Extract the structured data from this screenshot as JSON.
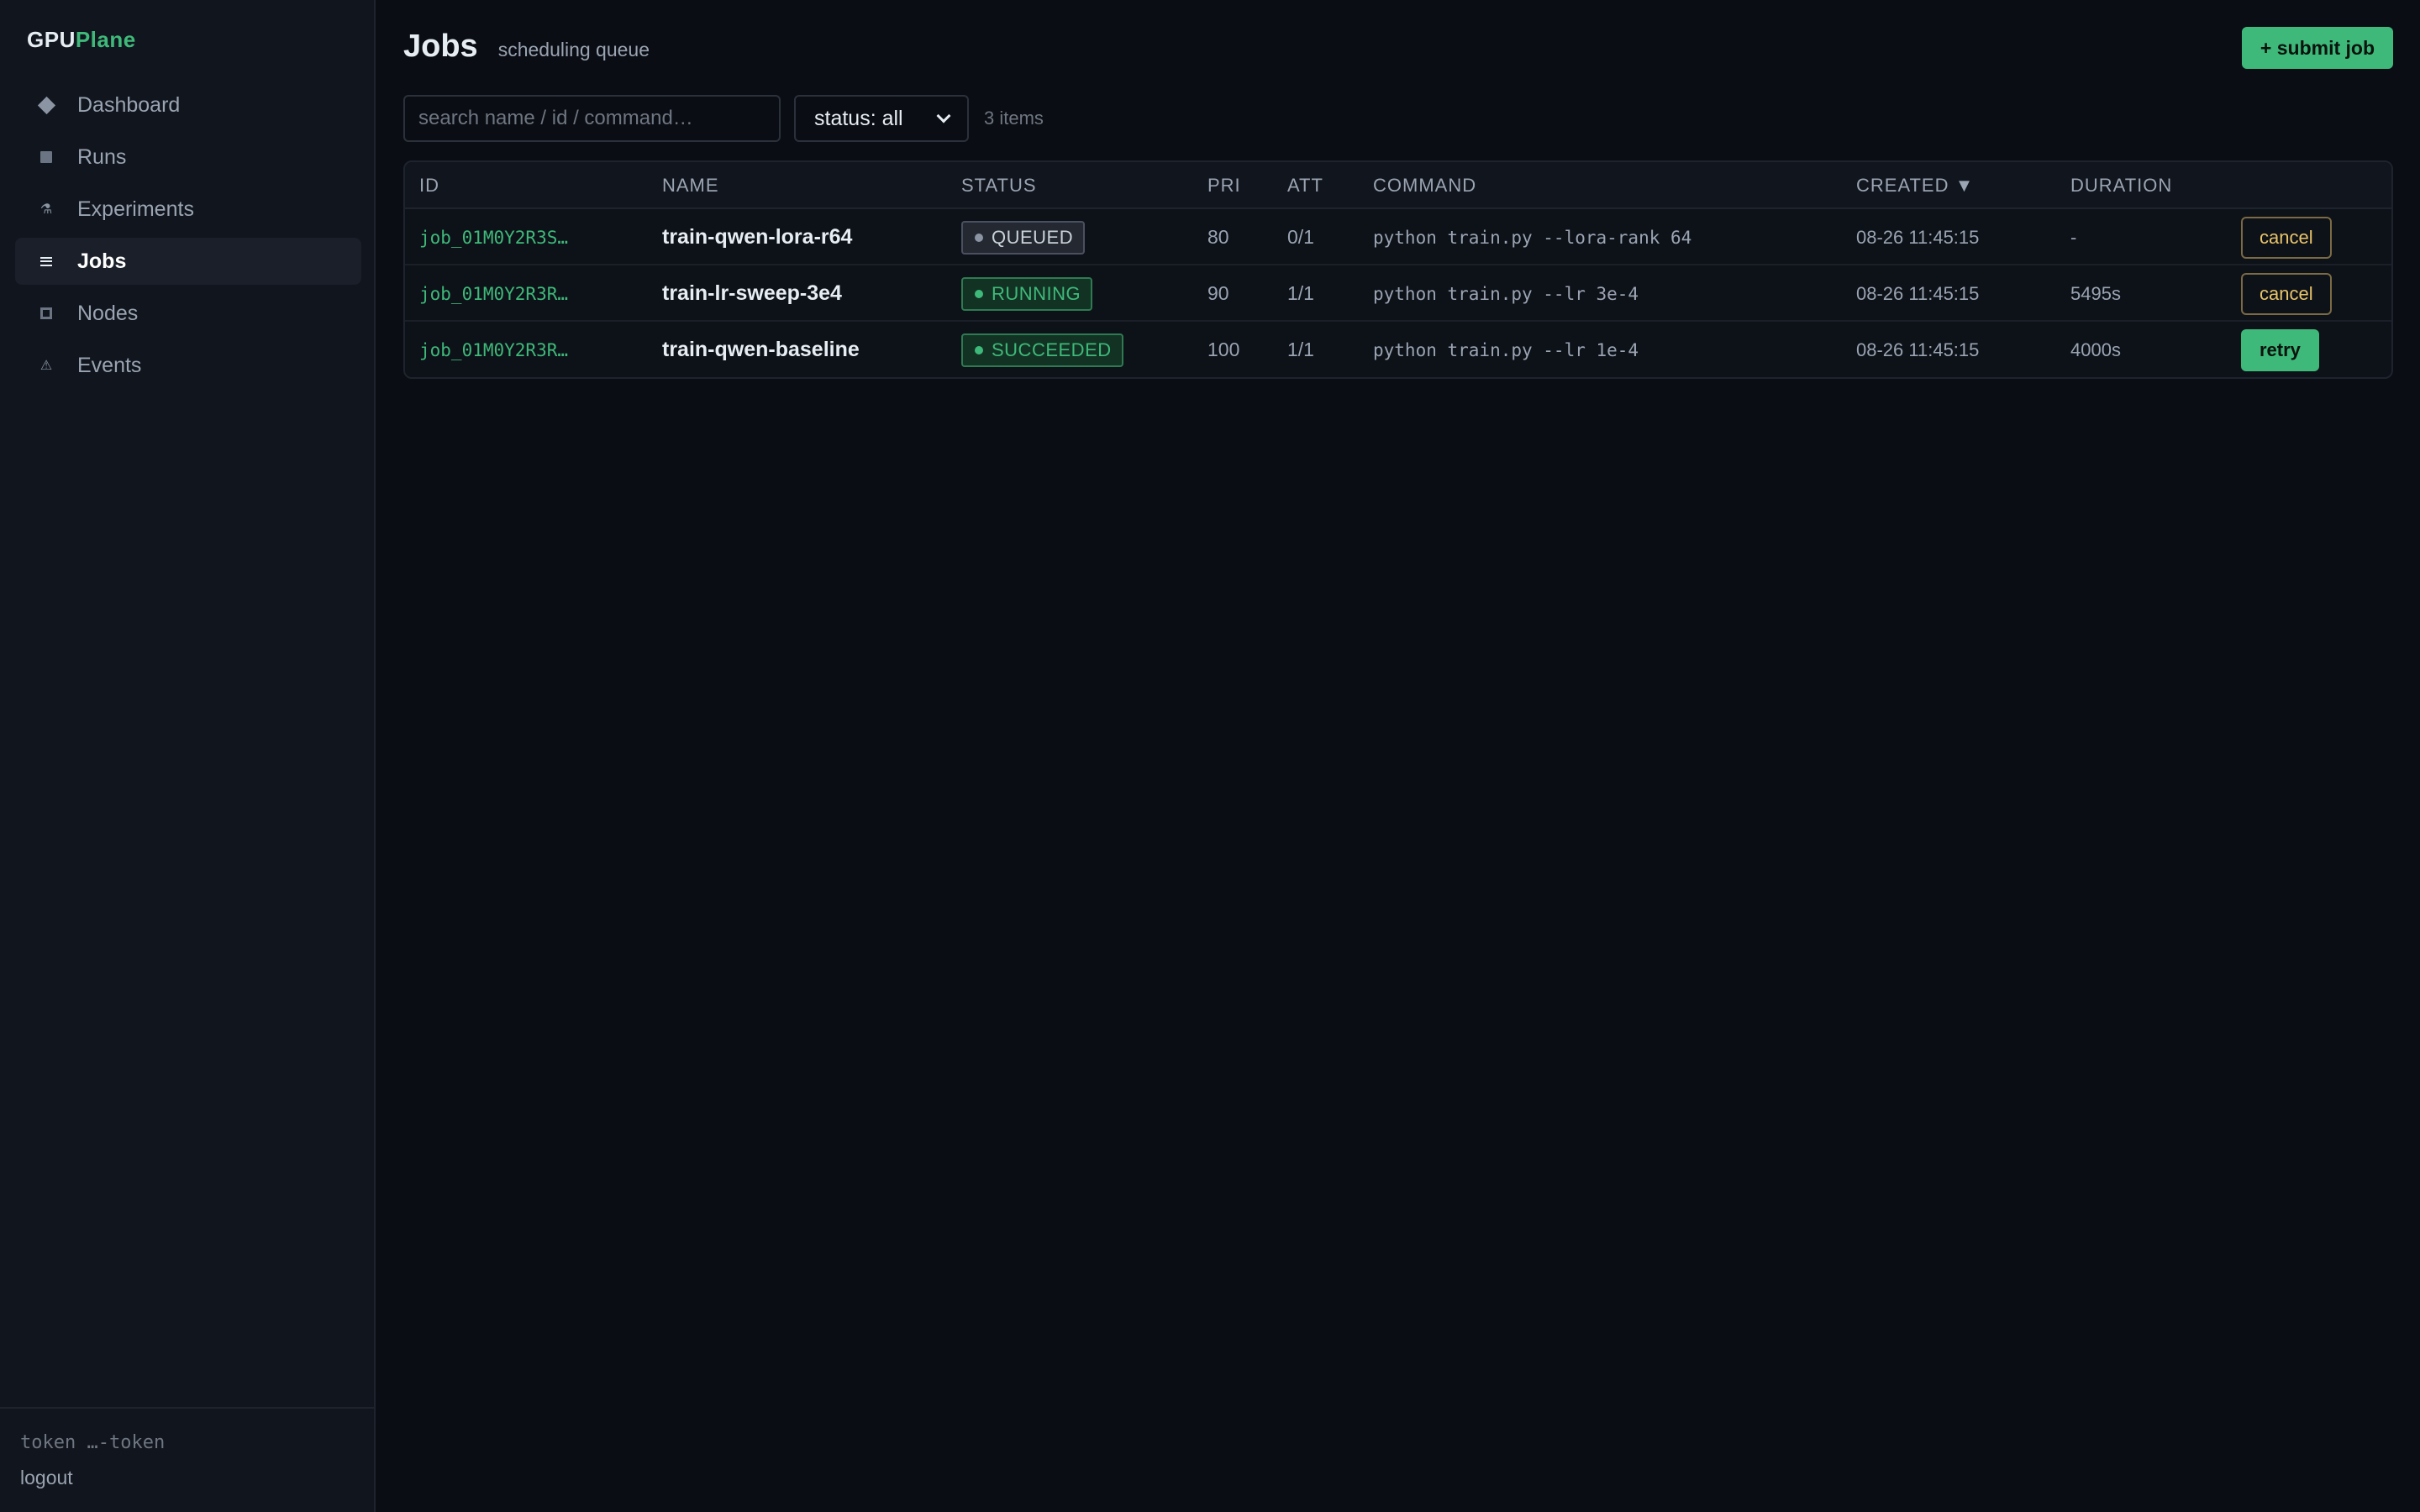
{
  "brand": {
    "part1": "GPU",
    "part2": "Plane"
  },
  "sidebar": {
    "items": [
      {
        "label": "Dashboard",
        "icon": "diamond-icon"
      },
      {
        "label": "Runs",
        "icon": "square-icon"
      },
      {
        "label": "Experiments",
        "icon": "flask-icon",
        "glyph": "⚗"
      },
      {
        "label": "Jobs",
        "icon": "list-icon",
        "active": true
      },
      {
        "label": "Nodes",
        "icon": "node-icon"
      },
      {
        "label": "Events",
        "icon": "warning-icon",
        "glyph": "⚠"
      }
    ],
    "token": "token …-token",
    "logout": "logout"
  },
  "header": {
    "title": "Jobs",
    "subtitle": "scheduling queue",
    "submit_label": "+ submit job"
  },
  "toolbar": {
    "search_placeholder": "search name / id / command…",
    "status_select": "status: all",
    "count": "3 items"
  },
  "table": {
    "columns": {
      "id": "ID",
      "name": "NAME",
      "status": "STATUS",
      "pri": "PRI",
      "att": "ATT",
      "command": "COMMAND",
      "created": "CREATED ▼",
      "duration": "DURATION"
    },
    "rows": [
      {
        "id": "job_01M0Y2R3S…",
        "name": "train-qwen-lora-r64",
        "status": "QUEUED",
        "pri": "80",
        "att": "0/1",
        "command": "python train.py --lora-rank 64",
        "created": "08-26 11:45:15",
        "duration": "-",
        "action": "cancel"
      },
      {
        "id": "job_01M0Y2R3R…",
        "name": "train-lr-sweep-3e4",
        "status": "RUNNING",
        "pri": "90",
        "att": "1/1",
        "command": "python train.py --lr 3e-4",
        "created": "08-26 11:45:15",
        "duration": "5495s",
        "action": "cancel"
      },
      {
        "id": "job_01M0Y2R3R…",
        "name": "train-qwen-baseline",
        "status": "SUCCEEDED",
        "pri": "100",
        "att": "1/1",
        "command": "python train.py --lr 1e-4",
        "created": "08-26 11:45:15",
        "duration": "4000s",
        "action": "retry"
      }
    ]
  },
  "colors": {
    "accent": "#3fb97a",
    "warning": "#e8c46a",
    "background": "#0a0d13",
    "sidebar": "#11151d"
  }
}
